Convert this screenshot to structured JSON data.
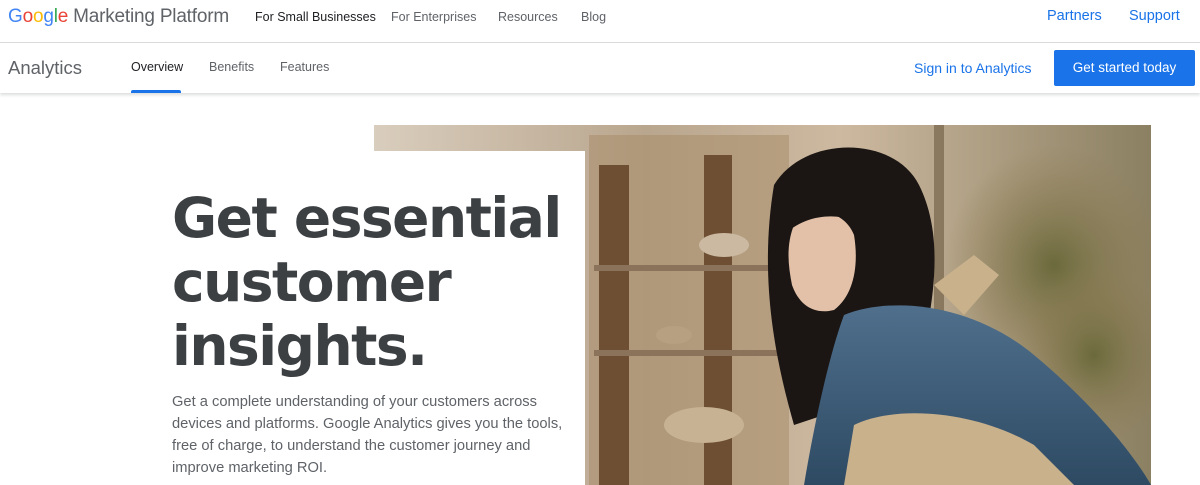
{
  "topbar": {
    "logo": {
      "google_letters": [
        {
          "ch": "G",
          "color": "#4285F4"
        },
        {
          "ch": "o",
          "color": "#EA4335"
        },
        {
          "ch": "o",
          "color": "#FBBC05"
        },
        {
          "ch": "g",
          "color": "#4285F4"
        },
        {
          "ch": "l",
          "color": "#34A853"
        },
        {
          "ch": "e",
          "color": "#EA4335"
        }
      ],
      "platform": "Marketing Platform"
    },
    "nav": [
      {
        "label": "For Small Businesses",
        "active": true
      },
      {
        "label": "For Enterprises",
        "active": false
      },
      {
        "label": "Resources",
        "active": false
      },
      {
        "label": "Blog",
        "active": false
      }
    ],
    "partners": "Partners",
    "support": "Support"
  },
  "subbar": {
    "product": "Analytics",
    "tabs": [
      {
        "label": "Overview",
        "active": true
      },
      {
        "label": "Benefits",
        "active": false
      },
      {
        "label": "Features",
        "active": false
      }
    ],
    "sign_in": "Sign in to Analytics",
    "cta": "Get started today"
  },
  "hero": {
    "headline_lines": [
      "Get essential",
      "customer",
      "insights."
    ],
    "body_lines": [
      "Get a complete understanding of your customers across",
      "devices and platforms. Google Analytics gives you the tools,",
      "free of charge, to understand the customer journey and",
      "improve marketing ROI."
    ],
    "image_icon": "photo-woman-in-shop"
  },
  "colors": {
    "accent": "#1a73e8",
    "text_primary": "#202124",
    "text_secondary": "#5f6368"
  }
}
